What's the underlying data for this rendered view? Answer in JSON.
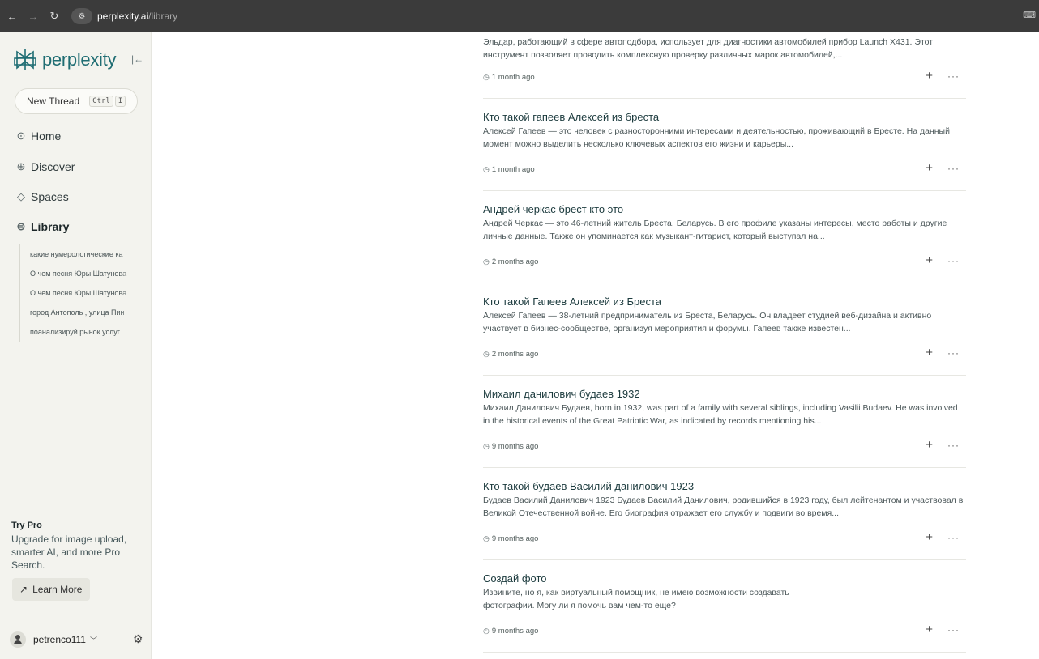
{
  "browser": {
    "url_host": "perplexity.ai",
    "url_path": "/library"
  },
  "sidebar": {
    "logo_text": "perplexity",
    "new_thread": {
      "label": "New Thread",
      "kbd1": "Ctrl",
      "kbd2": "I"
    },
    "nav": [
      {
        "label": "Home",
        "icon": "home-icon"
      },
      {
        "label": "Discover",
        "icon": "globe-icon"
      },
      {
        "label": "Spaces",
        "icon": "spaces-icon"
      },
      {
        "label": "Library",
        "icon": "library-icon"
      }
    ],
    "library_items": [
      "какие нумерологические ка",
      "О чем песня Юры Шатунова",
      "О чем песня Юры Шатунова",
      "город Антополь , улица Пин",
      "поанализируй рынок услуг"
    ],
    "try_pro": {
      "title": "Try Pro",
      "text": "Upgrade for image upload, smarter AI, and more Pro Search.",
      "button": "Learn More"
    },
    "user": {
      "name": "petrenco111"
    }
  },
  "threads": [
    {
      "title": "",
      "snippet": "Эльдар, работающий в сфере автоподбора, использует для диагностики автомобилей прибор Launch X431. Этот инструмент позволяет проводить комплексную проверку различных марок автомобилей,...",
      "time": "1 month ago"
    },
    {
      "title": "Кто такой гапеев Алексей из бреста",
      "snippet": "Алексей Гапеев — это человек с разносторонними интересами и деятельностью, проживающий в Бресте. На данный момент можно выделить несколько ключевых аспектов его жизни и карьеры...",
      "time": "1 month ago"
    },
    {
      "title": "Андрей черкас брест кто это",
      "snippet": "Андрей Черкас — это 46-летний житель Бреста, Беларусь. В его профиле указаны интересы, место работы и другие личные данные. Также он упоминается как музыкант-гитарист, который выступал на...",
      "time": "2 months ago"
    },
    {
      "title": "Кто такой Гапеев Алексей из Бреста",
      "snippet": "Алексей Гапеев — 38-летний предприниматель из Бреста, Беларусь. Он владеет студией веб-дизайна и активно участвует в бизнес-сообществе, организуя мероприятия и форумы. Гапеев также известен...",
      "time": "2 months ago"
    },
    {
      "title": "Михаил данилович будаев 1932",
      "snippet": "Михаил Данилович Будаев, born in 1932, was part of a family with several siblings, including Vasilii Budaev. He was involved in the historical events of the Great Patriotic War, as indicated by records mentioning his...",
      "time": "9 months ago"
    },
    {
      "title": "Кто такой будаев Василий данилович 1923",
      "snippet": "Будаев Василий Данилович 1923 Будаев Василий Данилович, родившийся в 1923 году, был лейтенантом и участвовал в Великой Отечественной войне. Его биография отражает его службу и подвиги во время...",
      "time": "9 months ago"
    },
    {
      "title": "Создай фото",
      "snippet": "Извините, но я, как виртуальный помощник, не имею возможности создавать фотографии. Могу ли я помочь вам чем-то еще?",
      "time": "9 months ago"
    }
  ]
}
